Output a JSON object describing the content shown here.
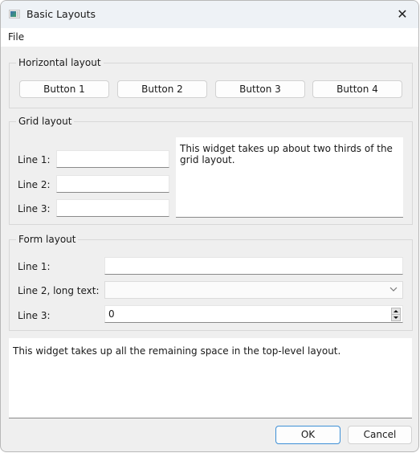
{
  "window": {
    "title": "Basic Layouts",
    "icons": {
      "app": "app-window-icon",
      "close": "close-icon"
    },
    "close_glyph": "✕"
  },
  "menubar": {
    "items": [
      {
        "label": "File"
      }
    ]
  },
  "horizontal_layout": {
    "title": "Horizontal layout",
    "buttons": [
      {
        "label": "Button 1"
      },
      {
        "label": "Button 2"
      },
      {
        "label": "Button 3"
      },
      {
        "label": "Button 4"
      }
    ]
  },
  "grid_layout": {
    "title": "Grid layout",
    "rows": [
      {
        "label": "Line 1:",
        "value": ""
      },
      {
        "label": "Line 2:",
        "value": ""
      },
      {
        "label": "Line 3:",
        "value": ""
      }
    ],
    "text_widget": "This widget takes up about two thirds of the grid layout."
  },
  "form_layout": {
    "title": "Form layout",
    "line1": {
      "label": "Line 1:",
      "value": ""
    },
    "line2": {
      "label": "Line 2, long text:",
      "selected": ""
    },
    "line3": {
      "label": "Line 3:",
      "value": "0"
    }
  },
  "big_text": "This widget takes up all the remaining space in the top-level layout.",
  "dialog_buttons": {
    "ok": "OK",
    "cancel": "Cancel"
  }
}
